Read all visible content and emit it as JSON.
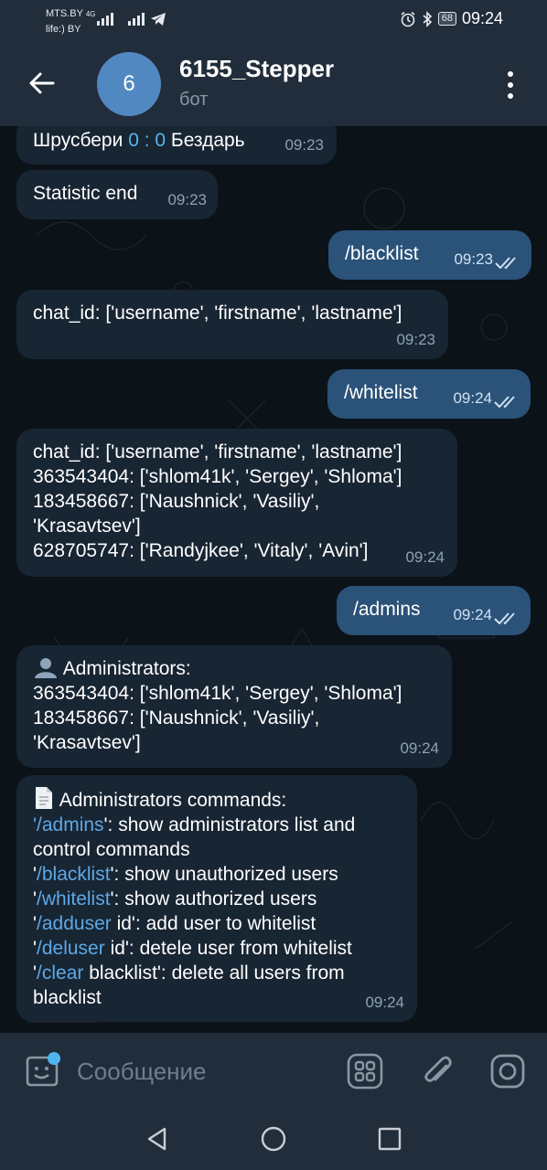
{
  "status": {
    "carrier1": "MTS.BY",
    "net1": "4G",
    "carrier2": "life:) BY",
    "battery": "68",
    "time": "09:24"
  },
  "header": {
    "avatar_letter": "6",
    "title": "6155_Stepper",
    "subtitle": "бот"
  },
  "messages": {
    "m1": {
      "prefix": "Шрусбери",
      "score": "0 : 0",
      "suffix": "Бездарь",
      "time": "09:23"
    },
    "m2": {
      "text": "Statistic end",
      "time": "09:23"
    },
    "m3": {
      "text": "/blacklist",
      "time": "09:23"
    },
    "m4": {
      "text": "chat_id: ['username', 'firstname', 'lastname']",
      "time": "09:23"
    },
    "m5": {
      "text": "/whitelist",
      "time": "09:24"
    },
    "m6": {
      "lines": [
        "chat_id: ['username', 'firstname', 'lastname']",
        "363543404: ['shlom41k', 'Sergey', 'Shloma']",
        "183458667: ['Naushnick', 'Vasiliy',",
        "'Krasavtsev']",
        "628705747: ['Randyjkee', 'Vitaly', 'Avin']"
      ],
      "time": "09:24"
    },
    "m7": {
      "text": "/admins",
      "time": "09:24"
    },
    "m8": {
      "head": "Administrators:",
      "lines": [
        "363543404: ['shlom41k', 'Sergey', 'Shloma']",
        "183458667: ['Naushnick', 'Vasiliy',",
        "'Krasavtsev']"
      ],
      "time": "09:24"
    },
    "m9": {
      "head": "Administrators commands:",
      "c1_link": "/admins",
      "c1_rest": "': show administrators list and",
      "c1_cont": "control commands",
      "c2_link": "/blacklist",
      "c2_rest": "': show unauthorized users",
      "c3_link": "/whitelist",
      "c3_rest": "': show authorized users",
      "c4_link": "/adduser",
      "c4_rest": " id': add user to whitelist",
      "c5_link": "/deluser",
      "c5_rest": " id': detele user from whitelist",
      "c6_link": "/clear",
      "c6_rest": " blacklist': delete all users from",
      "c6_cont": "blacklist",
      "time": "09:24"
    }
  },
  "input": {
    "placeholder": "Сообщение"
  },
  "colors": {
    "accent": "#5288c1",
    "out_bubble": "#2b5278",
    "in_bubble": "#182533",
    "link": "#5ea8e6"
  }
}
